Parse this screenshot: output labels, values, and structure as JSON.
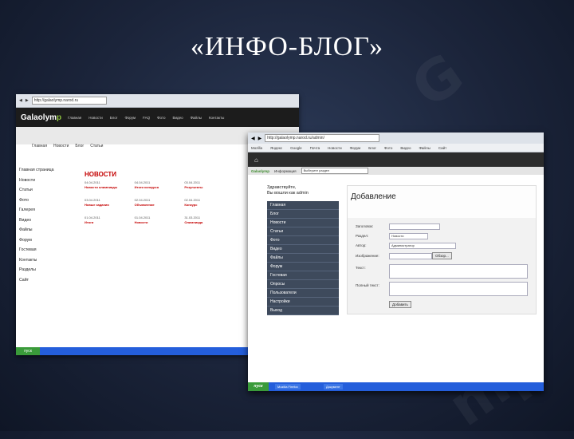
{
  "slide": {
    "title": "«ИНФО-БЛОГ»"
  },
  "back_screenshot": {
    "address": "http://galaolymp.narod.ru",
    "logo_main": "Galaolym",
    "logo_accent": "p",
    "menu": [
      "Главная",
      "Новости",
      "Блог",
      "Форум",
      "FAQ",
      "Фото",
      "Видео",
      "Файлы",
      "Контакты"
    ],
    "breadcrumb": [
      "Главная",
      "Новости",
      "Блог",
      "Статьи"
    ],
    "sidebar": [
      "Главная страница",
      "Новости",
      "Статьи",
      "Фото",
      "Галерея",
      "Видео",
      "Файлы",
      "Форум",
      "Гостевая",
      "Контакты",
      "Разделы",
      "Сайт"
    ],
    "news_heading": "НОВОСТИ",
    "cards": [
      {
        "date": "04.04.2011",
        "title": "Новости олимпиады"
      },
      {
        "date": "04.04.2011",
        "title": "Итоги конкурса"
      },
      {
        "date": "03.04.2011",
        "title": "Результаты"
      },
      {
        "date": "03.04.2011",
        "title": "Новые задания"
      },
      {
        "date": "02.04.2011",
        "title": "Объявление"
      },
      {
        "date": "02.04.2011",
        "title": "Конкурс"
      },
      {
        "date": "01.04.2011",
        "title": "Итоги"
      },
      {
        "date": "01.04.2011",
        "title": "Новости"
      },
      {
        "date": "31.03.2011",
        "title": "Олимпиада"
      }
    ],
    "start_label": "пуск"
  },
  "front_screenshot": {
    "address": "http://galaolymp.narod.ru/admin/",
    "bookmarks": [
      "Mozilla",
      "Яндекс",
      "Google",
      "Почта",
      "Новости",
      "Форум",
      "Блог",
      "Фото",
      "Видео",
      "Файлы",
      "Сайт"
    ],
    "stripe_logo": "Galaolymp",
    "stripe_text": "Информация",
    "stripe_select": "Выберите раздел",
    "hello_line1": "Здравствуйте,",
    "hello_line2": "Вы вошли как admin",
    "nav": [
      "Главная",
      "Блог",
      "Новости",
      "Статьи",
      "Фото",
      "Видео",
      "Файлы",
      "Форум",
      "Гостевая",
      "Опросы",
      "Пользователи",
      "Настройки",
      "Выход"
    ],
    "content_heading": "Добавление",
    "form": {
      "title_label": "Заголовок:",
      "category_label": "Раздел:",
      "category_value": "Новости",
      "author_label": "Автор:",
      "author_value": "Администратор",
      "image_label": "Изображение:",
      "browse_button": "Обзор...",
      "text_label": "Текст:",
      "full_text_label": "Полный текст:",
      "save_button": "Добавить"
    },
    "start_label": "пуск",
    "tasks": [
      "Mozilla Firefox",
      "Документ"
    ]
  }
}
